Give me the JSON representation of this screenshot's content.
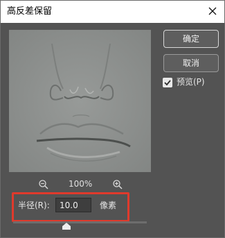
{
  "window": {
    "title": "高反差保留",
    "close_icon": "close-icon"
  },
  "preview": {
    "image": "high-pass-filtered face preview (nose and lips)",
    "zoom_out_icon": "zoom-out-icon",
    "zoom_in_icon": "zoom-in-icon",
    "zoom_level": "100%"
  },
  "buttons": {
    "ok_label": "确定",
    "cancel_label": "取消"
  },
  "preview_option": {
    "label": "预览(P)",
    "checked": true
  },
  "radius": {
    "label": "半径(R):",
    "value": "10.0",
    "unit": "像素",
    "slider_fraction": 0.4
  },
  "colors": {
    "dialog_bg": "#535353",
    "titlebar_bg": "#ffffff",
    "highlight": "#e03a2c",
    "preview_gray": "#8e918f"
  }
}
